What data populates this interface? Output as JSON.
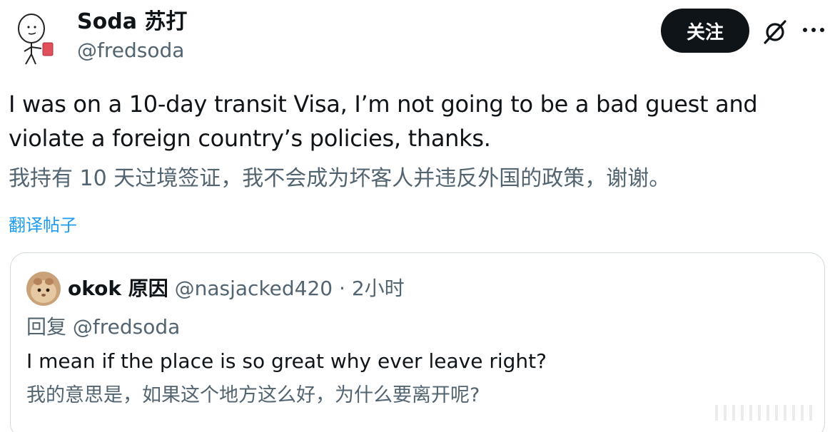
{
  "author": {
    "display_name": "Soda 苏打",
    "handle": "@fredsoda"
  },
  "actions": {
    "follow_label": "关注",
    "grok_icon": "grok-icon",
    "more_icon": "more-icon"
  },
  "tweet": {
    "text_en": "I was on a 10-day transit Visa, I’m not going to be a bad guest and violate a foreign country’s policies, thanks.",
    "text_zh": "我持有 10 天过境签证，我不会成为坏客人并违反外国的政策，谢谢。",
    "translate_label": "翻译帖子"
  },
  "quote": {
    "name": "okok 原因",
    "handle": "@nasjacked420",
    "separator": "·",
    "time": "2小时",
    "reply_to": "回复 @fredsoda",
    "text_en": "I mean if the place is so great why ever leave right?",
    "text_zh": "我的意思是，如果这个地方这么好，为什么要离开呢?"
  },
  "colors": {
    "text_primary": "#0f1419",
    "text_secondary": "#536471",
    "link": "#1d9bf0",
    "border": "#cfd9de",
    "button_bg": "#0f1419"
  }
}
